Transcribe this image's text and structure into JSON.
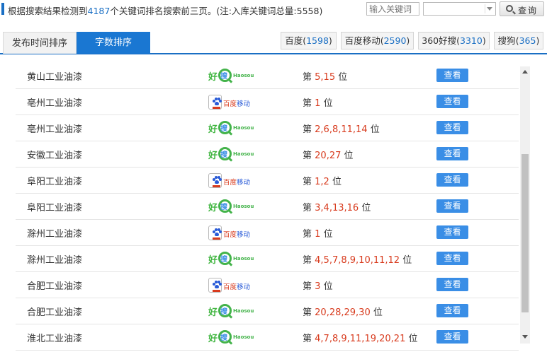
{
  "summary": {
    "prefix": "根据搜索结果检测到",
    "count": "4187",
    "suffix": "个关键词排名搜索前三页。(注:入库关键词总量:5558)"
  },
  "search": {
    "placeholder": "输入关键词",
    "button_label": "查询",
    "select_value": ""
  },
  "tabs": [
    {
      "label": "发布时间排序",
      "active": false
    },
    {
      "label": "字数排序",
      "active": true
    }
  ],
  "engines": [
    {
      "name": "百度",
      "count": "1598"
    },
    {
      "name": "百度移动",
      "count": "2590"
    },
    {
      "name": "360好搜",
      "count": "3310"
    },
    {
      "name": "搜狗",
      "count": "365"
    }
  ],
  "rank_prefix": "第",
  "rank_suffix": "位",
  "view_label": "查看",
  "logos": {
    "haosou": {
      "hao": "好",
      "sou": "搜",
      "en": "Haosou"
    },
    "baidu": {
      "red": "百度",
      "blue": "移动"
    }
  },
  "rows": [
    {
      "keyword": "黄山工业油漆",
      "engine": "haosou",
      "positions": "5,15"
    },
    {
      "keyword": "亳州工业油漆",
      "engine": "baidu",
      "positions": "1"
    },
    {
      "keyword": "亳州工业油漆",
      "engine": "haosou",
      "positions": "2,6,8,11,14"
    },
    {
      "keyword": "安徽工业油漆",
      "engine": "haosou",
      "positions": "20,27"
    },
    {
      "keyword": "阜阳工业油漆",
      "engine": "baidu",
      "positions": "1,2"
    },
    {
      "keyword": "阜阳工业油漆",
      "engine": "haosou",
      "positions": "3,4,13,16"
    },
    {
      "keyword": "滁州工业油漆",
      "engine": "baidu",
      "positions": "1"
    },
    {
      "keyword": "滁州工业油漆",
      "engine": "haosou",
      "positions": "4,5,7,8,9,10,11,12"
    },
    {
      "keyword": "合肥工业油漆",
      "engine": "baidu",
      "positions": "3"
    },
    {
      "keyword": "合肥工业油漆",
      "engine": "haosou",
      "positions": "20,28,29,30"
    },
    {
      "keyword": "淮北工业油漆",
      "engine": "haosou",
      "positions": "4,7,8,9,11,19,20,21"
    }
  ]
}
